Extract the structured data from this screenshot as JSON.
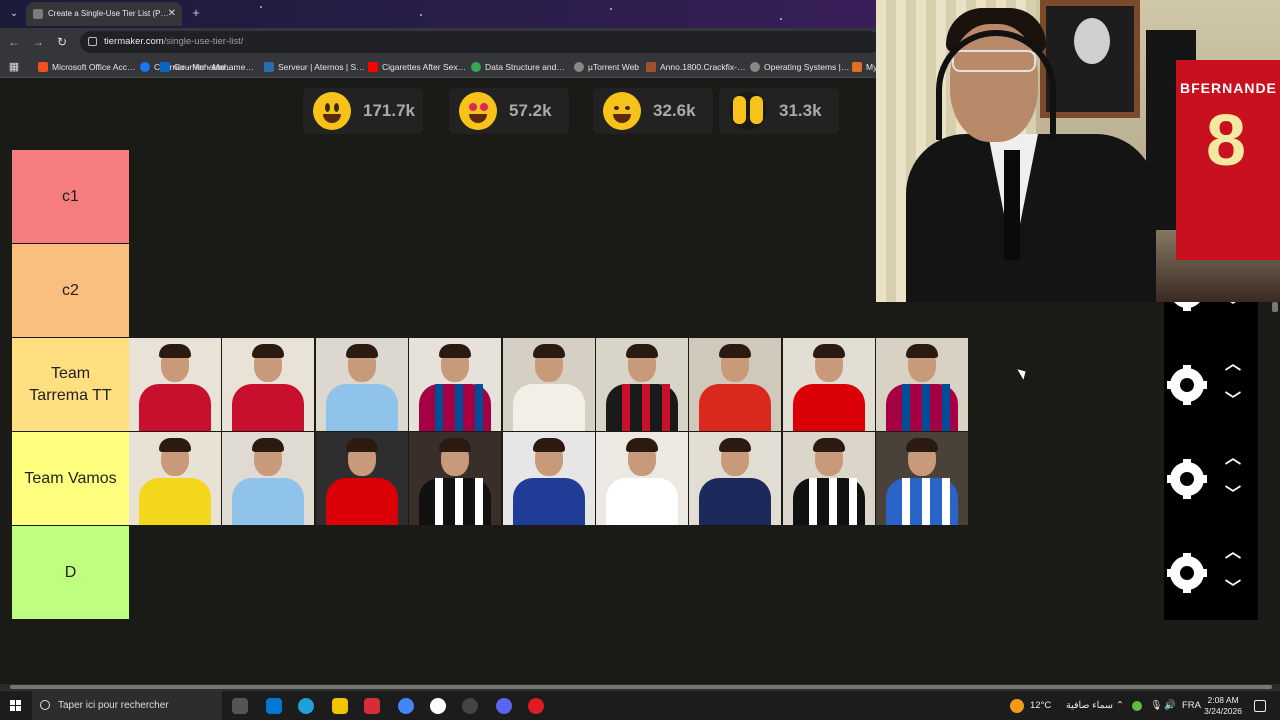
{
  "browser": {
    "tab_title": "Create a Single-Use Tier List (P…",
    "url_domain": "tiermaker.com",
    "url_path": "/single-use-tier-list/",
    "bookmarks": [
      {
        "label": "Microsoft Office Acc…",
        "color": "#f25022"
      },
      {
        "label": "Courrier - Mohame…",
        "color": "#1877f2"
      },
      {
        "label": "Courrier - Mohame…",
        "color": "#0a66c2"
      },
      {
        "label": "Serveur | Aternos | S…",
        "color": "#2b6cb0"
      },
      {
        "label": "Cigarettes After Sex…",
        "color": "#ff0000"
      },
      {
        "label": "Data Structure and…",
        "color": "#34a853"
      },
      {
        "label": "µTorrent Web",
        "color": "#888888"
      },
      {
        "label": "Anno.1800.Crackfix-…",
        "color": "#a0522d"
      },
      {
        "label": "Operating Systems |…",
        "color": "#888888"
      },
      {
        "label": "My",
        "color": "#e07020"
      }
    ]
  },
  "reactions": [
    {
      "emoji": "grinning-face",
      "count": "171.7k"
    },
    {
      "emoji": "heart-eyes-face",
      "count": "57.2k"
    },
    {
      "emoji": "tears-of-joy-face",
      "count": "32.6k"
    },
    {
      "emoji": "raising-hands",
      "count": "31.3k"
    }
  ],
  "tiers": [
    {
      "label": "c1",
      "color": "#f57d7f",
      "players": []
    },
    {
      "label": "c2",
      "color": "#fabf7f",
      "players": []
    },
    {
      "label": "Team Tarrema TT",
      "color": "#ffdf80",
      "players": [
        {
          "kit": "liverpool",
          "shirt": "#c8102e",
          "bg": "#e9e3d7"
        },
        {
          "kit": "liverpool",
          "shirt": "#c8102e",
          "bg": "#e9e3d7"
        },
        {
          "kit": "man-city",
          "shirt": "#8fc3ea",
          "bg": "#dcd8d0"
        },
        {
          "kit": "barcelona",
          "shirt": "#a50044",
          "bg": "#e6e2da",
          "stripe": "#004d98"
        },
        {
          "kit": "arsenal-away",
          "shirt": "#f2f0e6",
          "bg": "#d6d0c4"
        },
        {
          "kit": "ac-milan",
          "shirt": "#1a1a1a",
          "bg": "#d9d4c8",
          "stripe": "#c8102e"
        },
        {
          "kit": "man-united",
          "shirt": "#da291c",
          "bg": "#cfc8bb"
        },
        {
          "kit": "arsenal",
          "shirt": "#db0007",
          "bg": "#e3ded4"
        },
        {
          "kit": "barcelona",
          "shirt": "#a50044",
          "bg": "#d8d2c5",
          "stripe": "#004d98"
        }
      ]
    },
    {
      "label": "Team Vamos",
      "color": "#ffff7f",
      "players": [
        {
          "kit": "real-madrid-yellow",
          "shirt": "#f4d71c",
          "bg": "#e8e2d4"
        },
        {
          "kit": "man-city",
          "shirt": "#8fc3ea",
          "bg": "#e0dbd2"
        },
        {
          "kit": "arsenal",
          "shirt": "#db0007",
          "bg": "#2e2e2e"
        },
        {
          "kit": "newcastle",
          "shirt": "#111111",
          "bg": "#3a2e2a",
          "stripe": "#ffffff"
        },
        {
          "kit": "chelsea",
          "shirt": "#1f3c96",
          "bg": "#e6e6e6"
        },
        {
          "kit": "tottenham",
          "shirt": "#ffffff",
          "bg": "#ece9e2"
        },
        {
          "kit": "psg",
          "shirt": "#1b2a5a",
          "bg": "#e2ddd2"
        },
        {
          "kit": "juventus",
          "shirt": "#111111",
          "bg": "#dcd6ca",
          "stripe": "#ffffff"
        },
        {
          "kit": "brighton",
          "shirt": "#2a64c8",
          "bg": "#4a4238",
          "stripe": "#ffffff"
        }
      ]
    },
    {
      "label": "D",
      "color": "#bfff7f",
      "players": []
    }
  ],
  "webcam": {
    "jersey_name": "BFERNANDE",
    "jersey_number": "8"
  },
  "taskbar": {
    "search_placeholder": "Taper ici pour rechercher",
    "weather": "12°C",
    "weather_desc": "سماء صافية",
    "lang": "FRA",
    "time": "2:08 AM",
    "date": "3/24/2026"
  }
}
